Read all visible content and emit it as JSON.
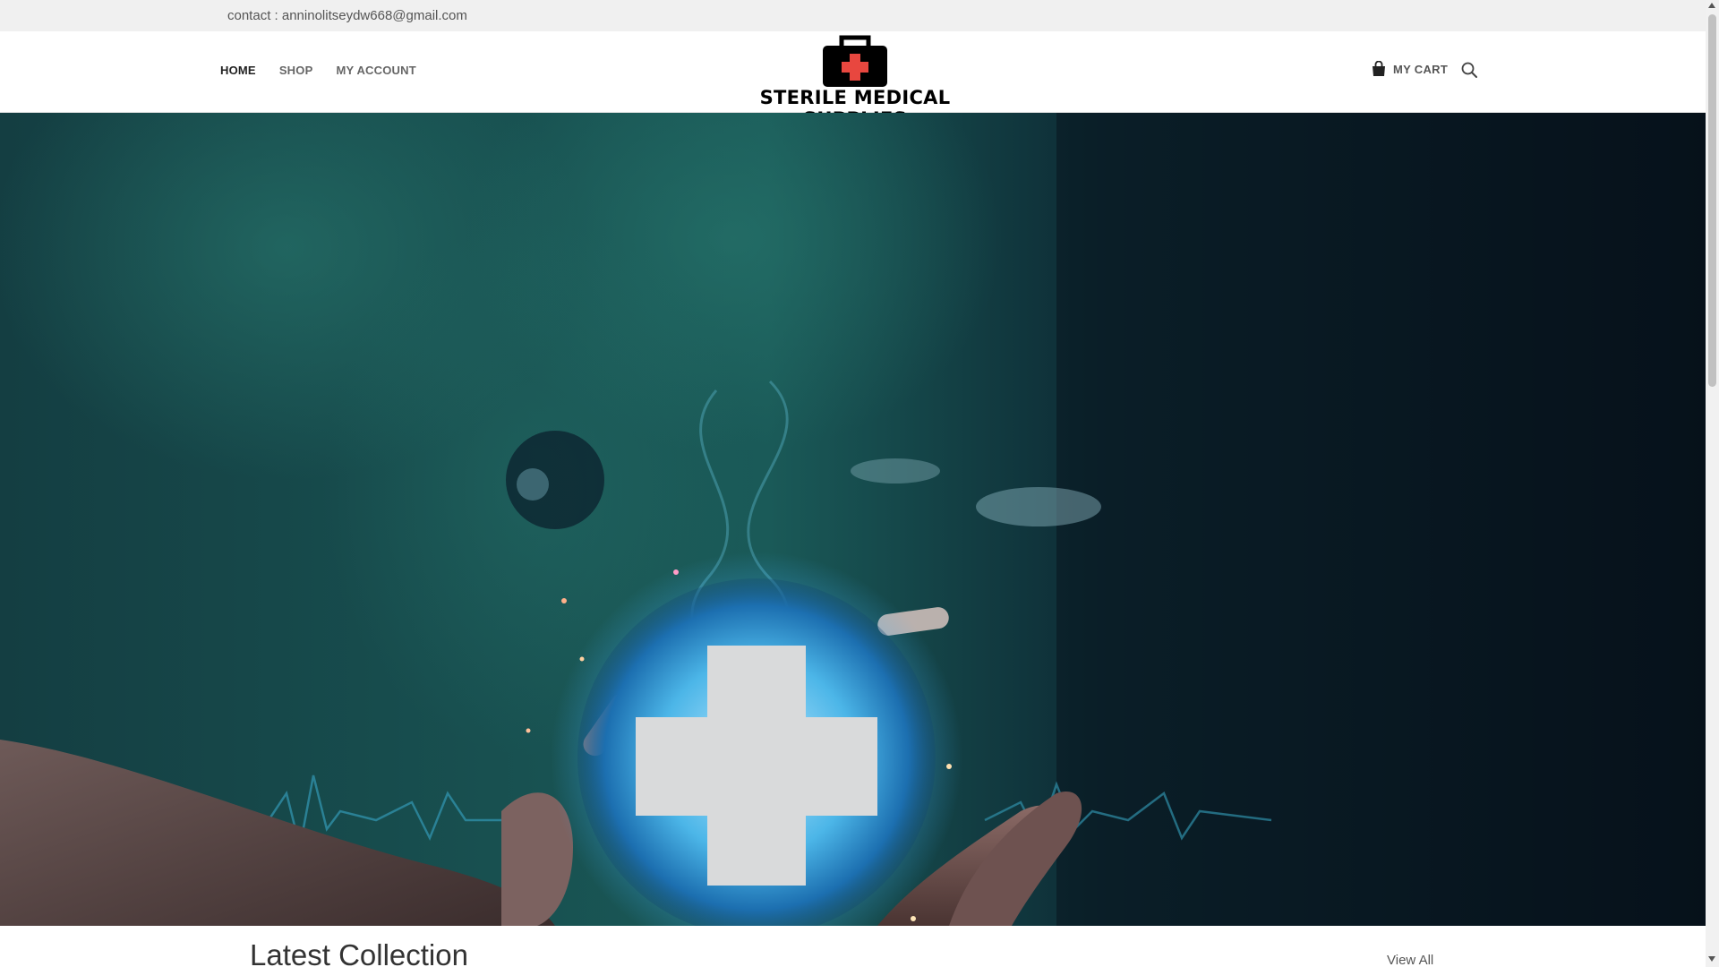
{
  "topbar": {
    "contact_text": "contact : anninolitseydw668@gmail.com"
  },
  "nav": {
    "items": [
      {
        "label": "HOME",
        "active": true
      },
      {
        "label": "SHOP",
        "active": false
      },
      {
        "label": "MY ACCOUNT",
        "active": false
      }
    ]
  },
  "logo": {
    "text": "STERILE MEDICAL SUPPLIES",
    "icon": "medical-kit-icon"
  },
  "header_actions": {
    "cart_label": "MY CART",
    "cart_icon": "shopping-bag-icon",
    "search_icon": "search-icon"
  },
  "hero": {
    "image": "doctor-hand-holding-glowing-medical-cross"
  },
  "section": {
    "title": "Latest Collection",
    "view_all_label": "View All"
  },
  "colors": {
    "topbar_bg": "#f0f0f0",
    "logo_cross": "#e8473f",
    "hero_dark": "#0a1c24",
    "hero_teal": "#1f6d66"
  }
}
